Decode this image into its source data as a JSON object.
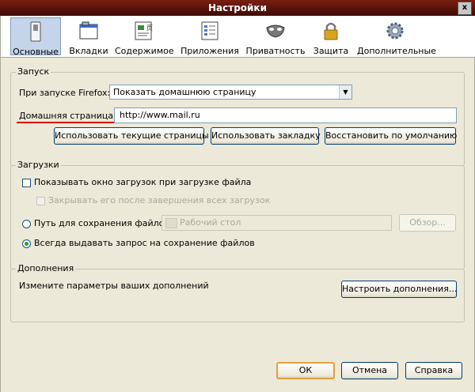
{
  "window": {
    "title": "Настройки",
    "close_glyph": "x"
  },
  "toolbar": {
    "items": [
      {
        "label": "Основные",
        "icon": "general-switch-icon",
        "selected": true
      },
      {
        "label": "Вкладки",
        "icon": "tabs-window-icon"
      },
      {
        "label": "Содержимое",
        "icon": "content-page-icon"
      },
      {
        "label": "Приложения",
        "icon": "applications-list-icon"
      },
      {
        "label": "Приватность",
        "icon": "privacy-mask-icon"
      },
      {
        "label": "Защита",
        "icon": "security-lock-icon"
      },
      {
        "label": "Дополнительные",
        "icon": "advanced-gear-icon"
      }
    ]
  },
  "startup": {
    "legend": "Запуск",
    "on_start_label": "При запуске Firefox:",
    "on_start_value": "Показать домашнюю страницу",
    "homepage_label": "Домашняя страница:",
    "homepage_value": "http://www.mail.ru",
    "btn_use_current": "Использовать текущие страницы",
    "btn_use_bookmark": "Использовать закладку",
    "btn_restore_default": "Восстановить по умолчанию"
  },
  "downloads": {
    "legend": "Загрузки",
    "show_window": "Показывать окно загрузок при загрузке файла",
    "close_after": "Закрывать его после завершения всех загрузок",
    "save_path_label": "Путь для сохранения файлов",
    "save_path_value": "Рабочий стол",
    "browse": "Обзор...",
    "always_ask": "Всегда выдавать запрос на сохранение файлов"
  },
  "addons": {
    "legend": "Дополнения",
    "description": "Измените параметры ваших дополнений",
    "button": "Настроить дополнения..."
  },
  "footer": {
    "ok": "ОК",
    "cancel": "Отмена",
    "help": "Справка"
  }
}
